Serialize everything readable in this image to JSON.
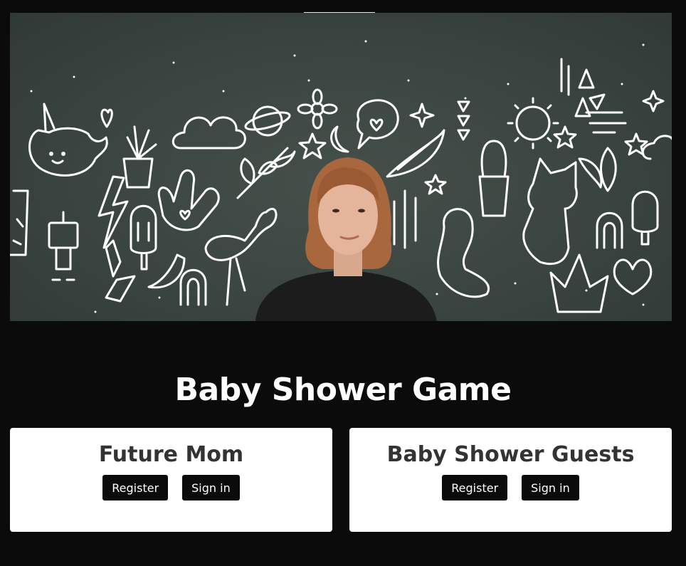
{
  "hero": {
    "image": "doodle-wall-woman-portrait",
    "colors": {
      "board": "#3a4440",
      "doodle": "#ffffff",
      "shirt": "#1c1c1c",
      "hair": "#a8673d",
      "skin": "#e4b59b"
    }
  },
  "page": {
    "title": "Baby Shower Game",
    "background": "#0b0b0b"
  },
  "cards": {
    "future_mom": {
      "title": "Future Mom",
      "register_label": "Register",
      "signin_label": "Sign in"
    },
    "guests": {
      "title": "Baby Shower Guests",
      "register_label": "Register",
      "signin_label": "Sign in"
    }
  }
}
